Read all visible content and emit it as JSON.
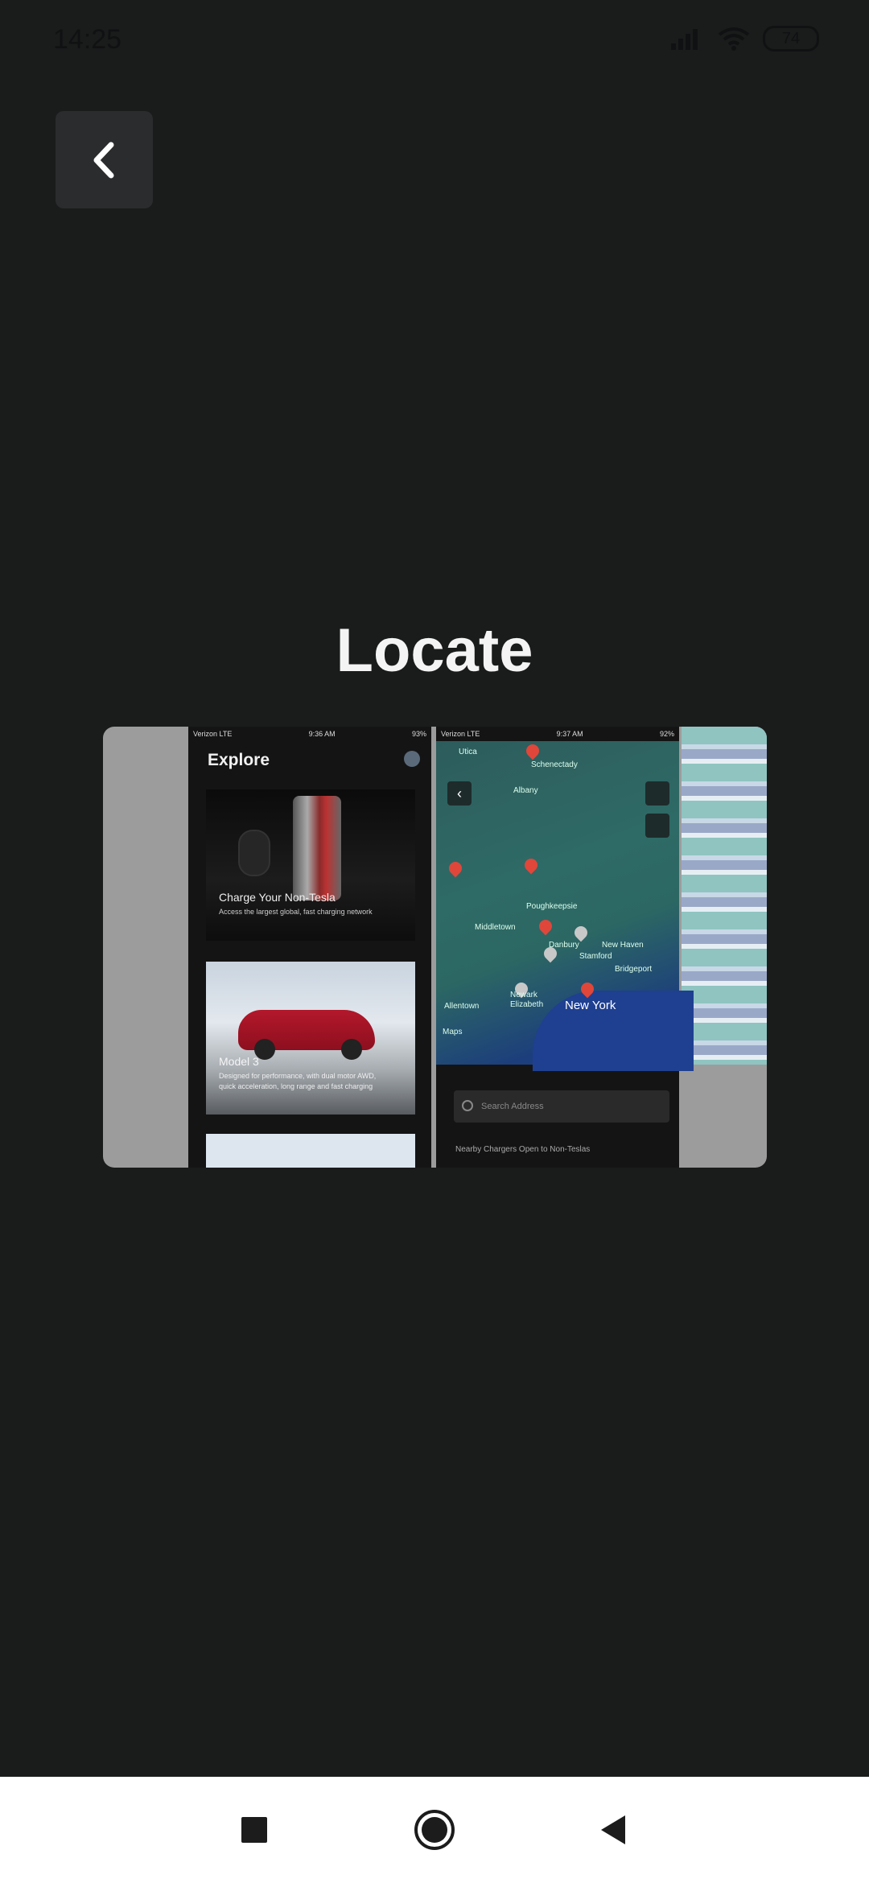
{
  "status_bar": {
    "time": "14:25",
    "battery": "74",
    "icons": [
      "signal-icon",
      "wifi-icon",
      "battery-icon"
    ]
  },
  "header": {
    "back_icon": "chevron-left-icon"
  },
  "main": {
    "title": "Locate",
    "image": {
      "left_screen": {
        "status": [
          "Verizon LTE",
          "9:36 AM",
          "93%"
        ],
        "heading": "Explore",
        "card1_title": "Charge Your Non-Tesla",
        "card1_subtitle": "Access the largest global, fast charging network",
        "card2_title": "Model 3",
        "card2_subtitle": "Designed for performance, with dual motor AWD, quick acceleration, long range and fast charging"
      },
      "right_screen": {
        "status": [
          "Verizon LTE",
          "9:37 AM",
          "92%"
        ],
        "map_labels": [
          "Utica",
          "Schenectady",
          "Albany",
          "Poughkeepsie",
          "Middletown",
          "Danbury",
          "New Haven",
          "Bridgeport",
          "Allentown",
          "Newark",
          "Elizabeth",
          "Stamford"
        ],
        "map_label_big": "New York",
        "maps_attribution": "Maps",
        "search_placeholder": "Search Address",
        "nearby_text": "Nearby Chargers Open to Non-Teslas"
      }
    }
  },
  "nav_bar": {
    "icons": [
      "recents-square-icon",
      "home-circle-icon",
      "back-triangle-icon"
    ]
  },
  "colors": {
    "background": "#1a1b1b",
    "back_button": "#2b2c2d",
    "title": "#f4f4f4",
    "nav_bar": "#ffffff",
    "pin": "#e0463a"
  }
}
